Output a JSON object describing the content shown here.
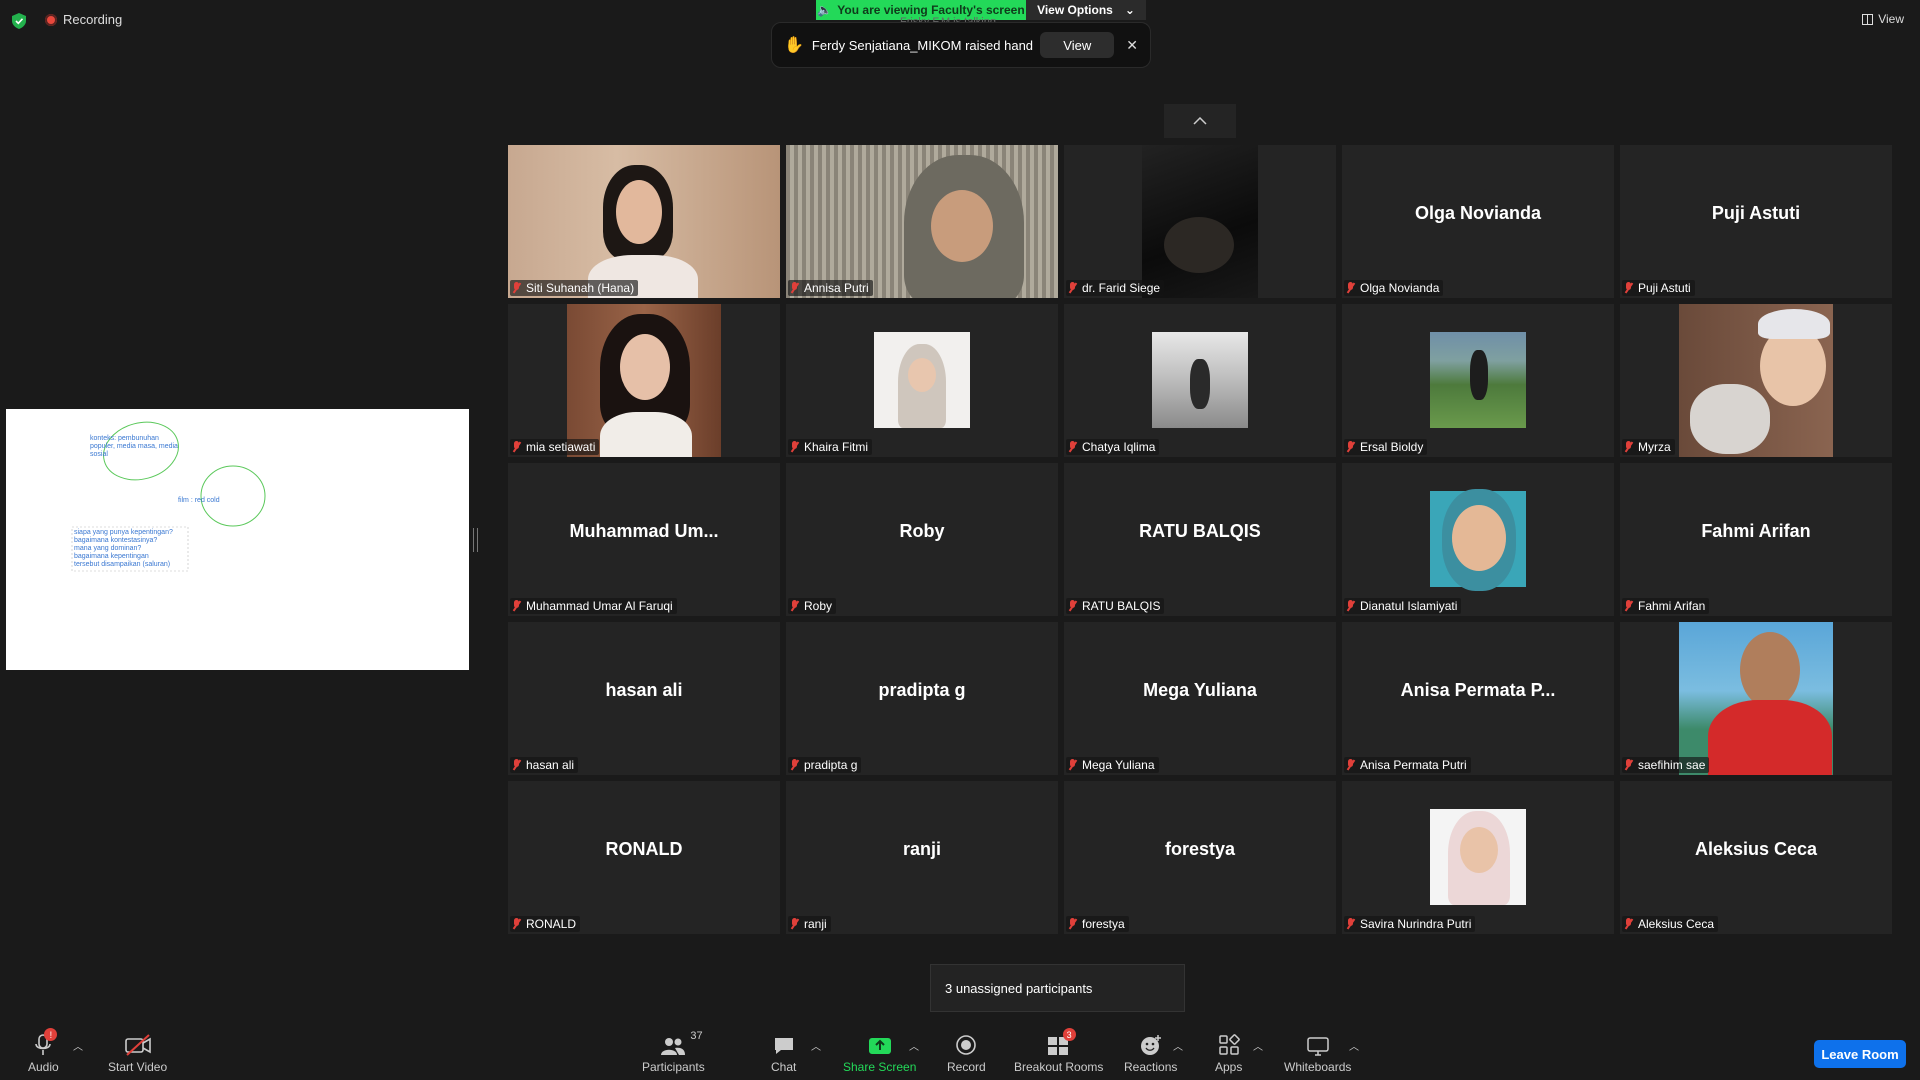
{
  "top_bar": {
    "recording_label": "Recording",
    "viewing_banner": "You are viewing Faculty's screen",
    "view_options": "View Options",
    "talking_text": "Frisky F.M is talking...",
    "view_label": "View"
  },
  "raise_hand_toast": {
    "message": "Ferdy Senjatiana_MIKOM raised hand",
    "view_button": "View"
  },
  "shared_screen": {
    "lines": [
      "konteks: pembunuhan",
      "populer, media masa, media",
      "sosial",
      "film : red cold",
      "siapa yang punya kepentingan?",
      "bagaimana kontestasinya?",
      "mana yang dominan?",
      "bagaimana kepentingan",
      "tersebut disampaikan (saluran)"
    ]
  },
  "participants": [
    {
      "name": "Siti Suhanah (Hana)",
      "display": "",
      "kind": "video"
    },
    {
      "name": "Annisa Putri",
      "display": "",
      "kind": "video"
    },
    {
      "name": "dr. Farid Siege",
      "display": "",
      "kind": "video"
    },
    {
      "name": "Olga Novianda",
      "display": "Olga Novianda",
      "kind": "text"
    },
    {
      "name": "Puji Astuti",
      "display": "Puji Astuti",
      "kind": "text"
    },
    {
      "name": "mia setiawati",
      "display": "",
      "kind": "video"
    },
    {
      "name": "Khaira Fitmi",
      "display": "",
      "kind": "photo"
    },
    {
      "name": "Chatya Iqlima",
      "display": "",
      "kind": "photo"
    },
    {
      "name": "Ersal Bioldy",
      "display": "",
      "kind": "photo"
    },
    {
      "name": "Myrza",
      "display": "",
      "kind": "video"
    },
    {
      "name": "Muhammad Umar Al Faruqi",
      "display": "Muhammad  Um...",
      "kind": "text"
    },
    {
      "name": "Roby",
      "display": "Roby",
      "kind": "text"
    },
    {
      "name": "RATU BALQIS",
      "display": "RATU BALQIS",
      "kind": "text"
    },
    {
      "name": "Dianatul Islamiyati",
      "display": "",
      "kind": "photo"
    },
    {
      "name": "Fahmi Arifan",
      "display": "Fahmi Arifan",
      "kind": "text"
    },
    {
      "name": "hasan ali",
      "display": "hasan ali",
      "kind": "text"
    },
    {
      "name": "pradipta g",
      "display": "pradipta g",
      "kind": "text"
    },
    {
      "name": "Mega Yuliana",
      "display": "Mega Yuliana",
      "kind": "text"
    },
    {
      "name": "Anisa Permata Putri",
      "display": "Anisa  Permata  P...",
      "kind": "text"
    },
    {
      "name": "saefihim sae",
      "display": "",
      "kind": "video"
    },
    {
      "name": "RONALD",
      "display": "RONALD",
      "kind": "text"
    },
    {
      "name": "ranji",
      "display": "ranji",
      "kind": "text"
    },
    {
      "name": "forestya",
      "display": "forestya",
      "kind": "text"
    },
    {
      "name": "Savira Nurindra Putri",
      "display": "",
      "kind": "photo"
    },
    {
      "name": "Aleksius Ceca",
      "display": "Aleksius Ceca",
      "kind": "text"
    }
  ],
  "unassigned_toast": "3 unassigned participants",
  "toolbar": {
    "audio": "Audio",
    "audio_badge": "!",
    "start_video": "Start Video",
    "participants": "Participants",
    "participants_count": "37",
    "chat": "Chat",
    "share_screen": "Share Screen",
    "record": "Record",
    "breakout_rooms": "Breakout Rooms",
    "breakout_badge": "3",
    "reactions": "Reactions",
    "apps": "Apps",
    "whiteboards": "Whiteboards",
    "leave_room": "Leave Room"
  },
  "colors": {
    "background": "#1a1a1a",
    "tile": "#242424",
    "banner_green": "#23d959",
    "share_green": "#23d959",
    "leave_blue": "#0e71eb",
    "muted_red": "#e0403a"
  }
}
